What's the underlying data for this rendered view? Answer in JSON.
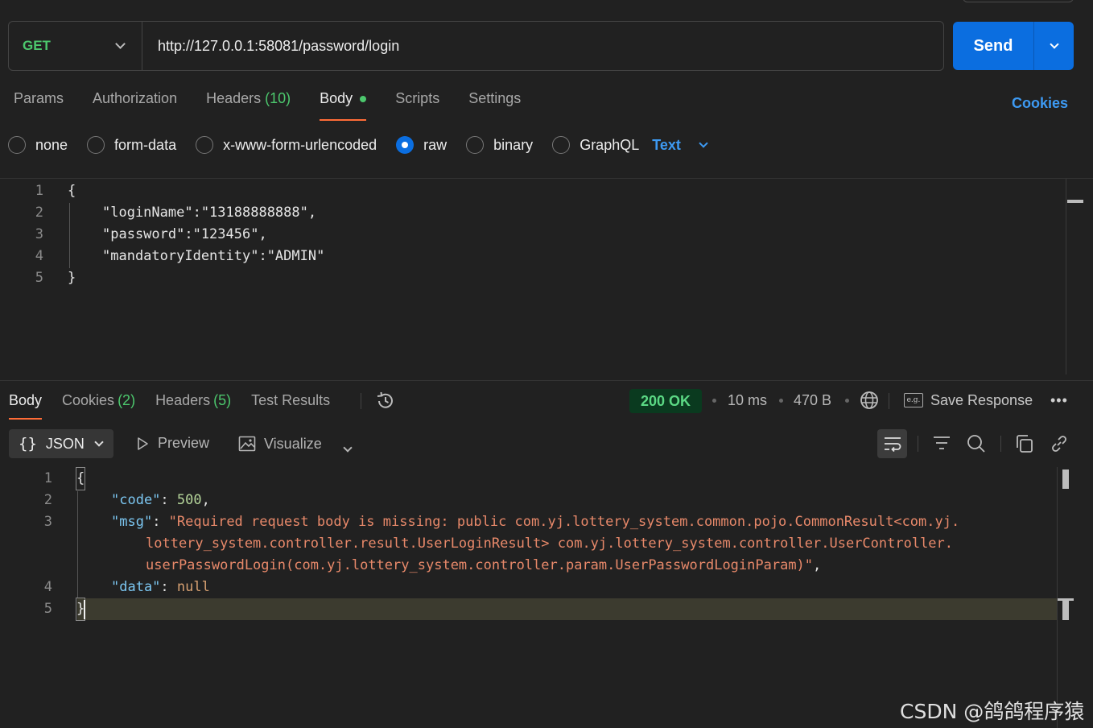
{
  "request": {
    "method": "GET",
    "url": "http://127.0.0.1:58081/password/login",
    "send_label": "Send",
    "tabs": [
      {
        "label": "Params"
      },
      {
        "label": "Authorization"
      },
      {
        "label": "Headers",
        "count": "(10)"
      },
      {
        "label": "Body",
        "active": true
      },
      {
        "label": "Scripts"
      },
      {
        "label": "Settings"
      }
    ],
    "cookies_label": "Cookies",
    "body_modes": [
      "none",
      "form-data",
      "x-www-form-urlencoded",
      "raw",
      "binary",
      "GraphQL"
    ],
    "selected_mode": "raw",
    "format": "Text",
    "body_lines": [
      {
        "n": "1",
        "text": "{"
      },
      {
        "n": "2",
        "text": "\"loginName\":\"13188888888\","
      },
      {
        "n": "3",
        "text": "\"password\":\"123456\","
      },
      {
        "n": "4",
        "text": "\"mandatoryIdentity\":\"ADMIN\""
      },
      {
        "n": "5",
        "text": "}"
      }
    ]
  },
  "response": {
    "tabs": [
      {
        "label": "Body",
        "active": true
      },
      {
        "label": "Cookies",
        "count": "(2)"
      },
      {
        "label": "Headers",
        "count": "(5)"
      },
      {
        "label": "Test Results"
      }
    ],
    "status": "200 OK",
    "time": "10 ms",
    "size": "470 B",
    "save_label": "Save Response",
    "view_mode": "JSON",
    "preview_label": "Preview",
    "visualize_label": "Visualize",
    "line_numbers": [
      "1",
      "2",
      "3",
      "4",
      "5"
    ],
    "json": {
      "open": "{",
      "code_key": "\"code\"",
      "code_value": "500",
      "msg_key": "\"msg\"",
      "msg_line1": "\"Required request body is missing: public com.yj.lottery_system.common.pojo.CommonResult<com.yj.",
      "msg_line2": "lottery_system.controller.result.UserLoginResult> com.yj.lottery_system.controller.UserController.",
      "msg_line3": "userPasswordLogin(com.yj.lottery_system.controller.param.UserPasswordLoginParam)\"",
      "data_key": "\"data\"",
      "data_value": "null",
      "close": "}"
    }
  },
  "colors": {
    "accent_orange": "#ff6c37",
    "send_blue": "#0b6ee0",
    "method_green": "#4cc76d",
    "link_blue": "#3d9af3"
  },
  "watermark": "CSDN @鸽鸽程序猿"
}
